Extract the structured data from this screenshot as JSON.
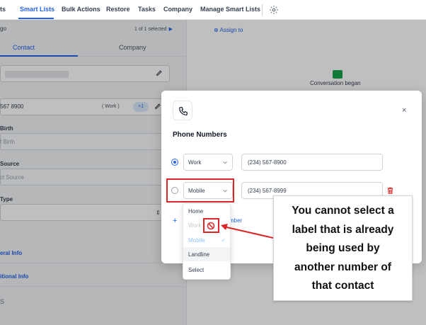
{
  "topnav": {
    "partial_left": "ts",
    "items": [
      "Smart Lists",
      "Bulk Actions",
      "Restore",
      "Tasks",
      "Company",
      "Manage Smart Lists"
    ]
  },
  "left_panel": {
    "top_partial": "go",
    "pagination": "1 of 1 selected",
    "tabs": [
      "Contact",
      "Company"
    ],
    "phone_partial": "567 8900",
    "phone_type": "( Work )",
    "phone_count": "+1",
    "birth_label": "Birth",
    "birth_placeholder": "f Birth",
    "source_label": "Source",
    "source_placeholder": "ct Source",
    "type_label": "Type",
    "general_info": "eral Info",
    "additional_info": "itional Info",
    "bottom_partial": "S"
  },
  "right_area": {
    "assign_label": "Assign to",
    "conversation_text": "Conversation began"
  },
  "modal": {
    "title": "Phone Numbers",
    "close": "×",
    "rows": [
      {
        "label": "Work",
        "number": "(234) 567-8900",
        "primary": true
      },
      {
        "label": "Mobile",
        "number": "(234) 567-8999",
        "primary": false
      }
    ],
    "add_partial": "mber"
  },
  "dropdown": {
    "options": [
      {
        "label": "Home",
        "state": "normal"
      },
      {
        "label": "Work",
        "state": "disabled"
      },
      {
        "label": "Mobile",
        "state": "selected"
      },
      {
        "label": "Landline",
        "state": "hover"
      },
      {
        "label": "Select",
        "state": "normal"
      }
    ]
  },
  "callout": {
    "lines": [
      "You cannot select a",
      "label that is already",
      "being used by",
      "another number of",
      "that contact"
    ]
  },
  "colors": {
    "accent": "#2563eb",
    "annotation_red": "#dc2626",
    "conversation_green": "#16a34a"
  }
}
